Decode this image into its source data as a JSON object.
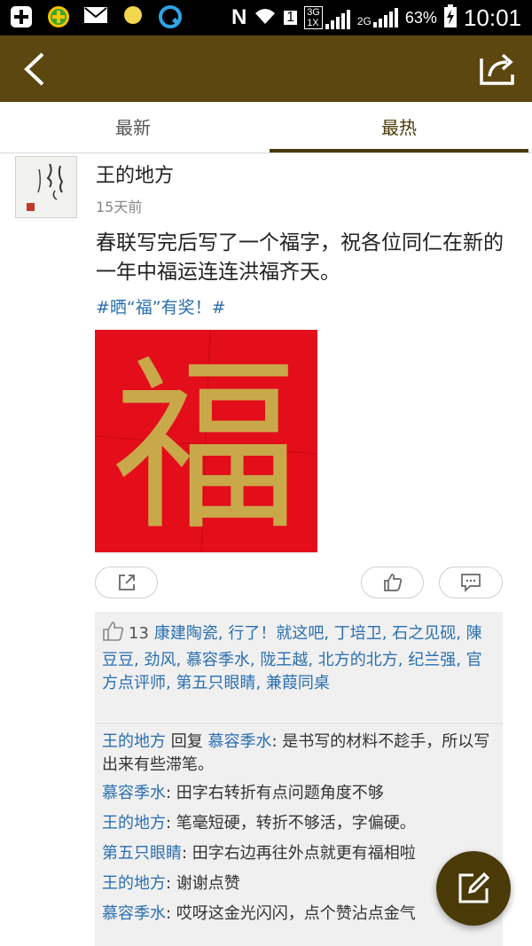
{
  "status_bar": {
    "icons": [
      "add-icon",
      "plus-badge-icon",
      "mail-icon",
      "dot-icon",
      "browser-icon",
      "nfc-icon",
      "wifi-icon",
      "sim-icon",
      "signal-3g-icon",
      "signal-2g-icon",
      "battery-icon"
    ],
    "sim_slot": "1",
    "net_3g": "3G",
    "net_1x": "1X",
    "net_2g": "2G",
    "battery": "63%",
    "time": "10:01"
  },
  "appbar": {
    "color": "#5c4710",
    "back_icon": "chevron-left-icon",
    "share_icon": "share-out-icon"
  },
  "tabs": [
    {
      "label": "最新",
      "active": false
    },
    {
      "label": "最热",
      "active": true
    }
  ],
  "post": {
    "author": "王的地方",
    "time": "15天前",
    "text": "春联写完后写了一个福字，祝各位同仁在新的一年中福运连连洪福齐天。",
    "tag": "#晒“福”有奖！#",
    "image_icon": "fu-character-red-paper",
    "image_character": "福"
  },
  "actions": {
    "share_icon": "share-box-icon",
    "like_icon": "thumbs-up-icon",
    "comment_icon": "comment-icon"
  },
  "likes": {
    "count": "13",
    "names": "康建陶瓷, 行了！就这吧, 丁培卫, 石之见砚, 陳豆豆, 劲风, 慕容季水, 陇王越, 北方的北方, 纪兰强, 官方点评师, 第五只眼睛, 兼葭同桌"
  },
  "comments": [
    {
      "user": "王的地方",
      "reply_word": "回复",
      "reply_to": "慕容季水",
      "text": ": 是书写的材料不趁手，所以写出来有些滞笔。"
    },
    {
      "user": "慕容季水",
      "text": ": 田字右转折有点问题角度不够"
    },
    {
      "user": "王的地方",
      "text": ": 笔毫短硬，转折不够活，字偏硬。"
    },
    {
      "user": "第五只眼睛",
      "text": ": 田字右边再往外点就更有福相啦"
    },
    {
      "user": "王的地方",
      "text": ": 谢谢点赞"
    },
    {
      "user": "慕容季水",
      "text": ": 哎呀这金光闪闪，点个赞沾点金气"
    }
  ],
  "fab_icon": "edit-pencil-icon"
}
